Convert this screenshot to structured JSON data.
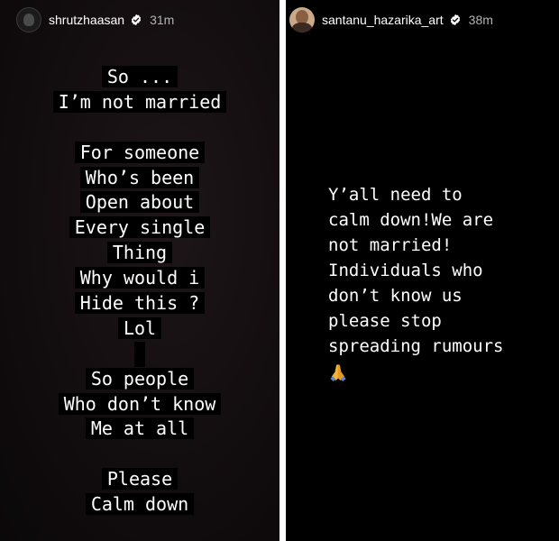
{
  "stories": [
    {
      "username": "shrutzhaasan",
      "verified_icon": "verified-badge-icon",
      "timestamp": "31m",
      "lines": [
        "So ...",
        "I’m not married",
        "",
        "For someone",
        "Who’s been",
        "Open about",
        "Every single",
        "Thing",
        "Why would i",
        "Hide this ?",
        "Lol",
        "",
        "So people",
        "Who don’t know",
        "Me at all",
        "",
        "Please",
        "Calm down"
      ]
    },
    {
      "username": "santanu_hazarika_art",
      "verified_icon": "verified-badge-icon",
      "timestamp": "38m",
      "lines": [
        "Y’all need to",
        "calm down!We are",
        "not married!",
        "Individuals who",
        "don’t know us",
        "please stop",
        "spreading rumours"
      ],
      "emoji": "folded-hands-icon"
    }
  ],
  "colors": {
    "left_bg": "#150f11",
    "right_bg": "#000000",
    "text": "#ffffff",
    "highlight": "#000000",
    "timestamp": "#b3b3b3",
    "verified": "#ffffff"
  }
}
